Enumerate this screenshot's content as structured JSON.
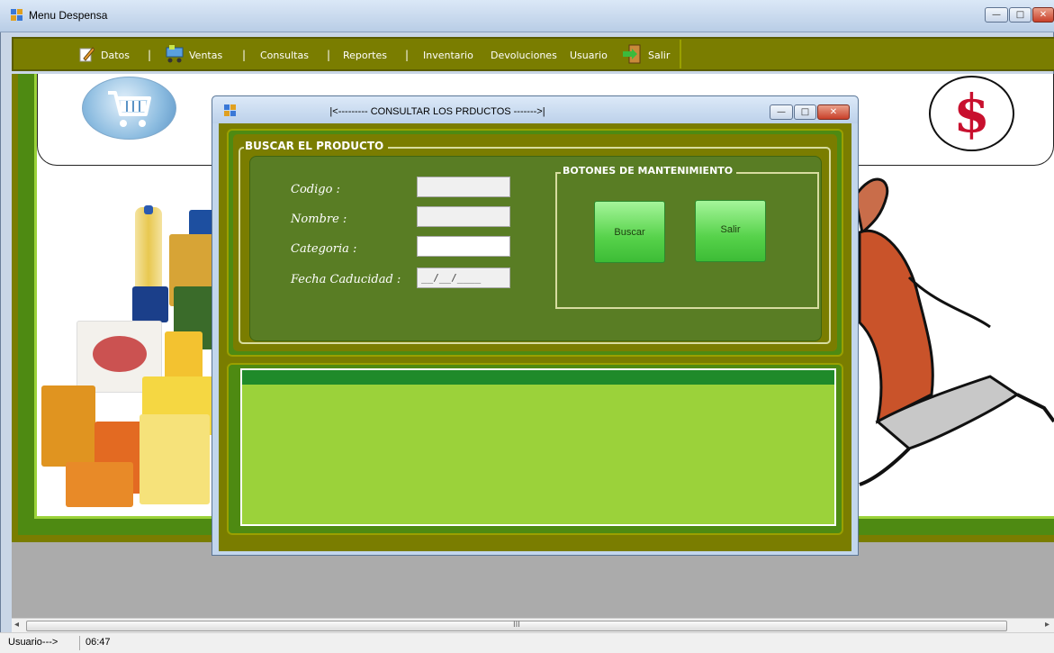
{
  "main_window": {
    "title": "Menu Despensa",
    "minimize_glyph": "—",
    "maximize_glyph": "□",
    "close_glyph": "✕"
  },
  "menu": {
    "items": [
      {
        "label": "Datos",
        "icon": "edit-icon"
      },
      {
        "label": "Ventas",
        "icon": "cart-icon"
      },
      {
        "label": "Consultas"
      },
      {
        "label": "Reportes"
      },
      {
        "label": "Inventario"
      },
      {
        "label": "Devoluciones"
      },
      {
        "label": "Usuario"
      },
      {
        "label": "Salir",
        "icon": "exit-icon"
      }
    ],
    "separator": "|"
  },
  "dialog": {
    "title": "|<---------  CONSULTAR LOS PRDUCTOS  ------->|",
    "group_search_label": "BUSCAR EL PRODUCTO",
    "fields": [
      {
        "label": "Codigo :",
        "value": ""
      },
      {
        "label": "Nombre :",
        "value": ""
      },
      {
        "label": "Categoria :",
        "value": ""
      },
      {
        "label": "Fecha Caducidad :",
        "value": "__/__/____"
      }
    ],
    "group_actions_label": "BOTONES DE MANTENIMIENTO",
    "buttons": {
      "search": "Buscar",
      "exit": "Salir"
    }
  },
  "scrollbar": {
    "grip": "III",
    "left_arrow": "◂",
    "right_arrow": "▸"
  },
  "status_bar": {
    "user_label": "Usuario--->",
    "time": "06:47"
  },
  "colors": {
    "olive": "#7a7d00",
    "dark_green": "#4e8a12",
    "light_green": "#9bd23a",
    "button_green": "#56d24a",
    "header_green": "#1f8a2a"
  }
}
